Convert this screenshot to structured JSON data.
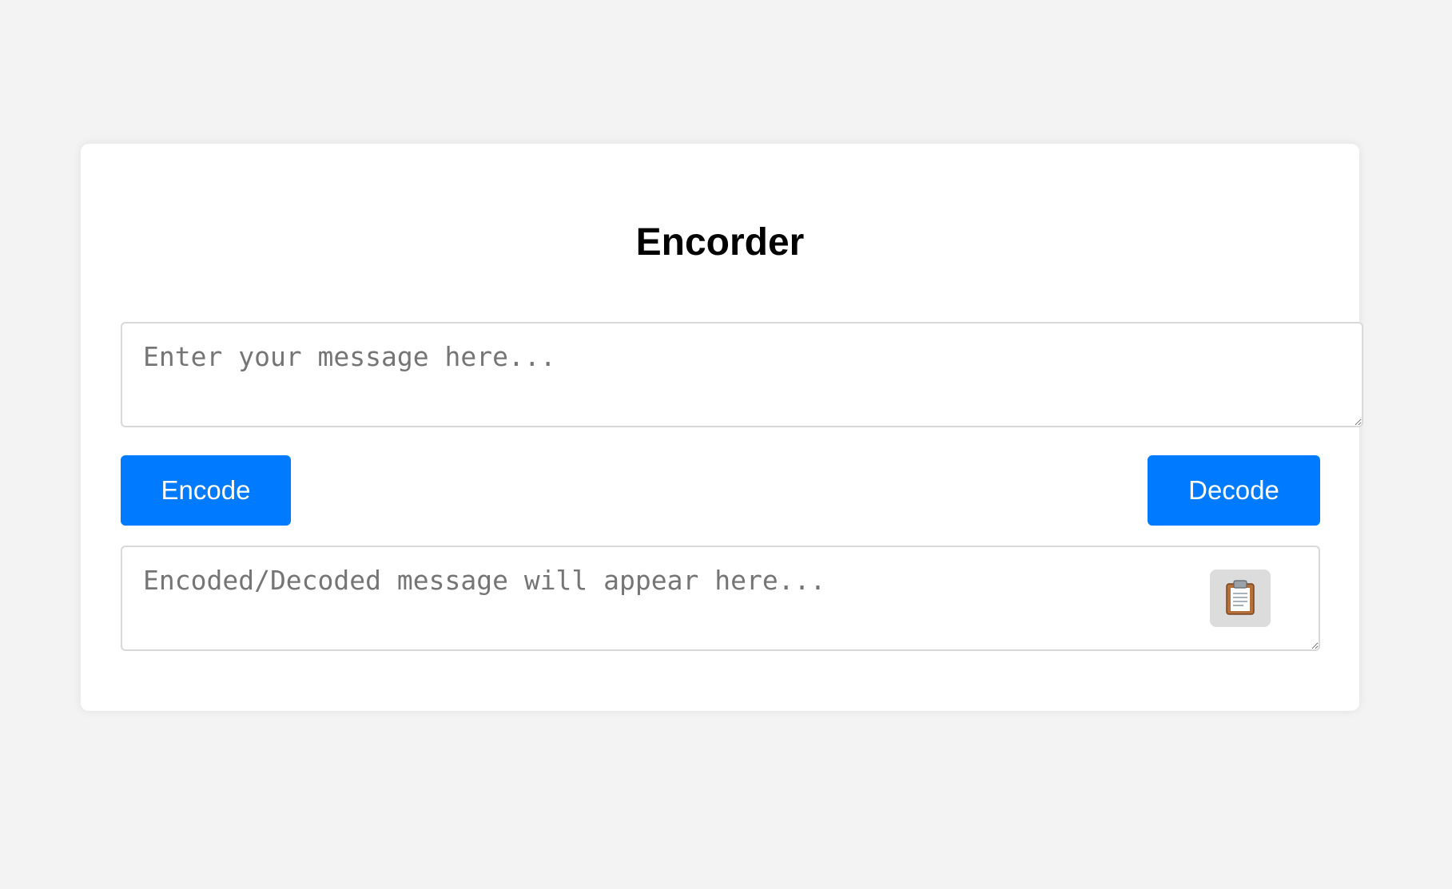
{
  "app": {
    "title": "Encorder"
  },
  "input": {
    "placeholder": "Enter your message here...",
    "value": ""
  },
  "actions": {
    "encode_label": "Encode",
    "decode_label": "Decode"
  },
  "output": {
    "placeholder": "Encoded/Decoded message will appear here...",
    "value": ""
  },
  "copy_button": {
    "icon": "clipboard-icon"
  },
  "colors": {
    "accent": "#007bff",
    "background": "#f3f3f3",
    "card": "#ffffff",
    "copy_button_bg": "#dcdcdc"
  }
}
